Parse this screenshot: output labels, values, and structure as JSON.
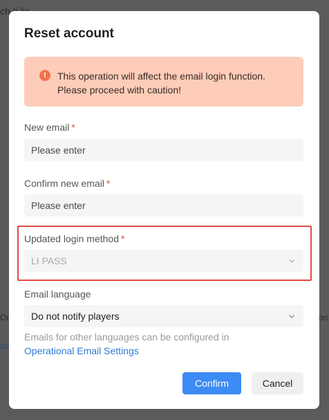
{
  "background": {
    "top_text": "ch ti lic",
    "left_text": "Ou",
    "right_text": "ori",
    "left_link_text": "ad"
  },
  "modal": {
    "title": "Reset account",
    "alert": {
      "icon": "exclamation-circle-icon",
      "icon_glyph": "!",
      "line1": "This operation will affect the email login function.",
      "line2": "Please proceed with caution!",
      "background_color": "#fdcdb9",
      "icon_color": "#f4734a"
    },
    "fields": {
      "new_email": {
        "label": "New email",
        "required_mark": "*",
        "placeholder": "Please enter"
      },
      "confirm_email": {
        "label": "Confirm new email",
        "required_mark": "*",
        "placeholder": "Please enter"
      },
      "login_method": {
        "label": "Updated login method",
        "required_mark": "*",
        "value": "LI PASS",
        "disabled": true
      },
      "email_language": {
        "label": "Email language",
        "value": "Do not notify players"
      }
    },
    "hint": "Emails for other languages can be configured in",
    "link": "Operational Email Settings",
    "buttons": {
      "confirm": "Confirm",
      "cancel": "Cancel"
    }
  },
  "colors": {
    "primary": "#3d8cf5",
    "link": "#2f7bd5",
    "required": "#e0483b",
    "highlight_border": "#e24b44"
  }
}
